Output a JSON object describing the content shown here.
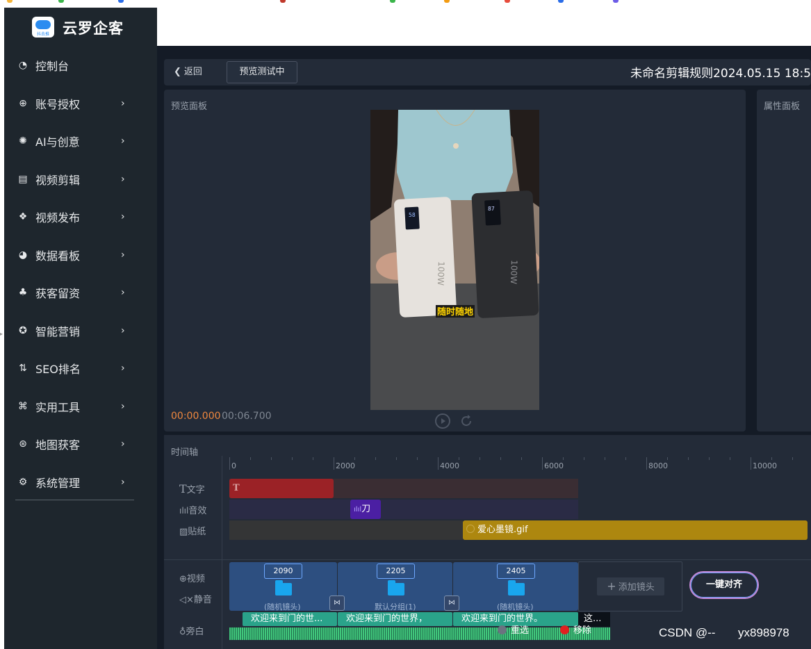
{
  "brand": {
    "name": "云罗企客",
    "logo_sub": "抖去推"
  },
  "nav": [
    {
      "label": "控制台",
      "icon": "dashboard-icon",
      "glyph": "◔",
      "arrow": false
    },
    {
      "label": "账号授权",
      "icon": "crosshair-icon",
      "glyph": "⊕",
      "arrow": true
    },
    {
      "label": "AI与创意",
      "icon": "brain-icon",
      "glyph": "✺",
      "arrow": true
    },
    {
      "label": "视频剪辑",
      "icon": "film-icon",
      "glyph": "▤",
      "arrow": true
    },
    {
      "label": "视频发布",
      "icon": "cluster-icon",
      "glyph": "❖",
      "arrow": true
    },
    {
      "label": "数据看板",
      "icon": "pie-chart-icon",
      "glyph": "◕",
      "arrow": true
    },
    {
      "label": "获客留资",
      "icon": "sitemap-icon",
      "glyph": "♣",
      "arrow": true
    },
    {
      "label": "智能营销",
      "icon": "palette-icon",
      "glyph": "✪",
      "arrow": true
    },
    {
      "label": "SEO排名",
      "icon": "sort-icon",
      "glyph": "⇅",
      "arrow": true
    },
    {
      "label": "实用工具",
      "icon": "command-icon",
      "glyph": "⌘",
      "arrow": true
    },
    {
      "label": "地图获客",
      "icon": "map-icon",
      "glyph": "⊛",
      "arrow": true
    },
    {
      "label": "系统管理",
      "icon": "gear-icon",
      "glyph": "⚙",
      "arrow": true
    }
  ],
  "toolbar": {
    "back_label": "返回",
    "preview_label": "预览测试中",
    "title": "未命名剪辑规则2024.05.15 18:5"
  },
  "preview": {
    "label": "预览面板",
    "time_current": "00:00.000",
    "time_total": "00:06.700",
    "caption": "随时随地",
    "battery_left": "58",
    "battery_right": "87",
    "brand_text": "100W"
  },
  "properties": {
    "label": "属性面板"
  },
  "timeline": {
    "label": "时间轴",
    "ruler": [
      "0",
      "2000",
      "4000",
      "6000",
      "8000",
      "10000"
    ],
    "tracks": {
      "text": "文字",
      "audio": "音效",
      "sticker": "贴纸",
      "video": "视频",
      "mute": "静音",
      "narration": "旁白"
    },
    "text_seg_glyph": "T",
    "audio_seg_label": "刀",
    "sticker_seg_label": "爱心墨镜.gif",
    "clips": [
      {
        "id": "2090",
        "label": "(随机镜头)"
      },
      {
        "id": "2205",
        "label": "默认分组(1)"
      },
      {
        "id": "2405",
        "label": "(随机镜头)"
      }
    ],
    "add_clip_label": "添加镜头",
    "align_label": "一键对齐",
    "narration": [
      "欢迎来到门的世...",
      "欢迎来到门的世界，",
      "欢迎来到门的世界。",
      "这..."
    ],
    "ctx_reselect": "重选",
    "ctx_remove": "移除"
  },
  "watermark": {
    "left": "CSDN @--",
    "right": "yx898978"
  },
  "colors": {
    "sidebar": "#1e262d",
    "main_bg": "#141b26",
    "panel": "#232b38",
    "accent_time": "#f0883e",
    "text_seg": "#9b2226",
    "sticker_seg": "#ad870f",
    "clip": "#2d4f80",
    "narration": "#2aa38a"
  }
}
